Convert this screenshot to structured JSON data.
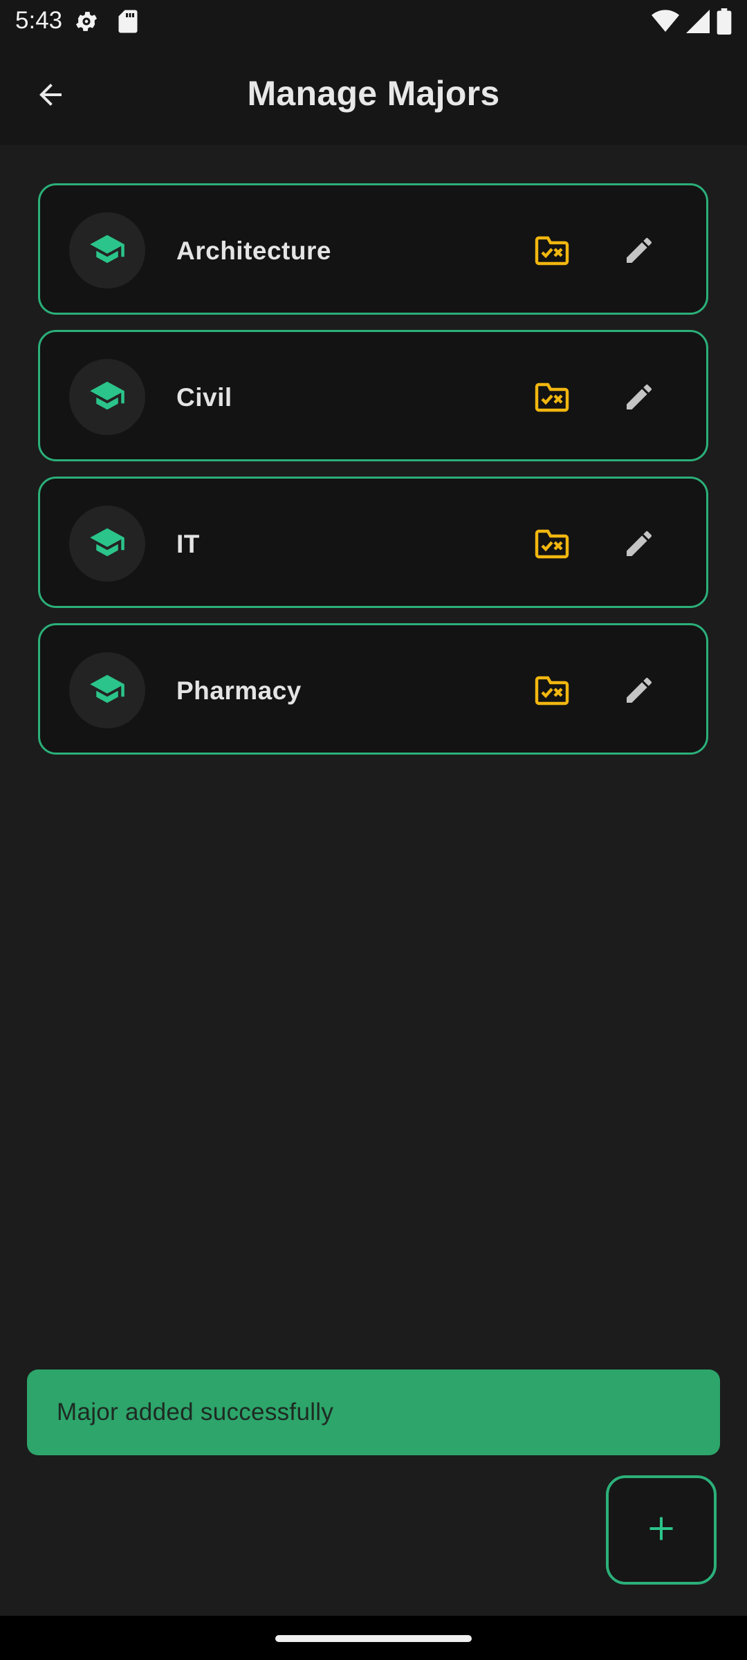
{
  "status_bar": {
    "time": "5:43",
    "icons": [
      "gear-icon",
      "sd-card-icon",
      "wifi-icon",
      "signal-icon",
      "battery-icon"
    ]
  },
  "app_bar": {
    "title": "Manage Majors",
    "back_icon": "arrow-back-icon"
  },
  "majors": [
    {
      "name": "Architecture"
    },
    {
      "name": "Civil"
    },
    {
      "name": "IT"
    },
    {
      "name": "Pharmacy"
    }
  ],
  "row_icons": {
    "avatar": "graduation-cap-icon",
    "folder": "folder-check-x-icon",
    "edit": "pencil-icon"
  },
  "snackbar": {
    "message": "Major added successfully"
  },
  "fab": {
    "icon": "plus-icon"
  },
  "colors": {
    "accent": "#2bb07a",
    "folder_icon": "#f2b70f",
    "snackbar_bg": "#2da56b",
    "background": "#1c1c1c"
  }
}
